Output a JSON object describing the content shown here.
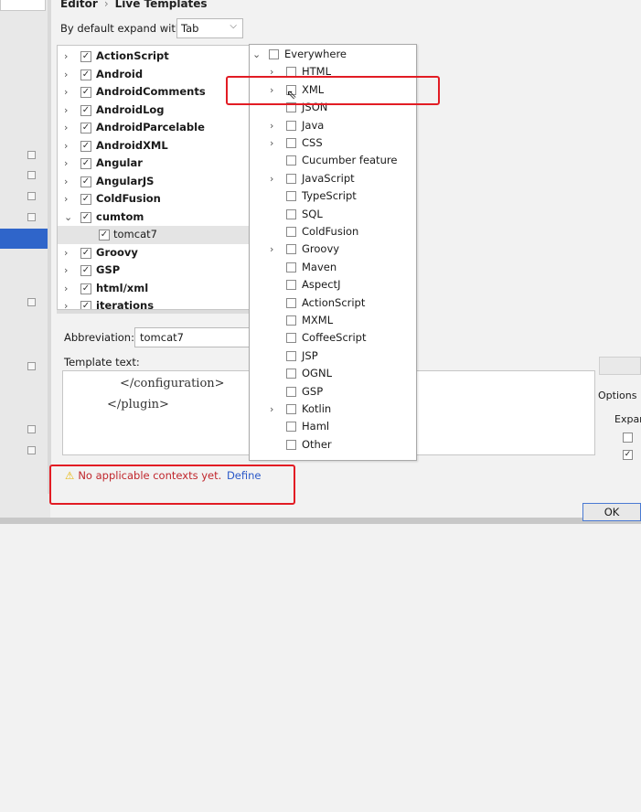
{
  "breadcrumb": {
    "parent": "Editor",
    "separator": "›",
    "current": "Live Templates"
  },
  "expand": {
    "label": "By default expand with",
    "value": "Tab"
  },
  "tree": {
    "items": [
      {
        "label": "ActionScript",
        "checked": true,
        "expanded": false
      },
      {
        "label": "Android",
        "checked": true,
        "expanded": false
      },
      {
        "label": "AndroidComments",
        "checked": true,
        "expanded": false
      },
      {
        "label": "AndroidLog",
        "checked": true,
        "expanded": false
      },
      {
        "label": "AndroidParcelable",
        "checked": true,
        "expanded": false
      },
      {
        "label": "AndroidXML",
        "checked": true,
        "expanded": false
      },
      {
        "label": "Angular",
        "checked": true,
        "expanded": false
      },
      {
        "label": "AngularJS",
        "checked": true,
        "expanded": false
      },
      {
        "label": "ColdFusion",
        "checked": true,
        "expanded": false
      },
      {
        "label": "cumtom",
        "checked": true,
        "expanded": true
      },
      {
        "label": "tomcat7",
        "checked": true,
        "child": true,
        "selected": true
      },
      {
        "label": "Groovy",
        "checked": true,
        "expanded": false
      },
      {
        "label": "GSP",
        "checked": true,
        "expanded": false
      },
      {
        "label": "html/xml",
        "checked": true,
        "expanded": false
      },
      {
        "label": "iterations",
        "checked": true,
        "expanded": false
      }
    ]
  },
  "abbreviation": {
    "label": "Abbreviation:",
    "value": "tomcat7"
  },
  "template": {
    "label": "Template text:",
    "lines": [
      "</configuration>",
      "</plugin>"
    ]
  },
  "options": {
    "label": "Options",
    "expand_label": "Expar"
  },
  "warning": {
    "text": "No applicable contexts yet.",
    "link": "Define"
  },
  "ok_button": "OK",
  "context_popup": {
    "items": [
      {
        "label": "Everywhere",
        "arrow": true,
        "root": true
      },
      {
        "label": "HTML",
        "arrow": true
      },
      {
        "label": "XML",
        "arrow": true
      },
      {
        "label": "JSON",
        "arrow": false
      },
      {
        "label": "Java",
        "arrow": true
      },
      {
        "label": "CSS",
        "arrow": true
      },
      {
        "label": "Cucumber feature",
        "arrow": false
      },
      {
        "label": "JavaScript",
        "arrow": true
      },
      {
        "label": "TypeScript",
        "arrow": false
      },
      {
        "label": "SQL",
        "arrow": false
      },
      {
        "label": "ColdFusion",
        "arrow": false
      },
      {
        "label": "Groovy",
        "arrow": true
      },
      {
        "label": "Maven",
        "arrow": false
      },
      {
        "label": "AspectJ",
        "arrow": false
      },
      {
        "label": "ActionScript",
        "arrow": false
      },
      {
        "label": "MXML",
        "arrow": false
      },
      {
        "label": "CoffeeScript",
        "arrow": false
      },
      {
        "label": "JSP",
        "arrow": false
      },
      {
        "label": "OGNL",
        "arrow": false
      },
      {
        "label": "GSP",
        "arrow": false
      },
      {
        "label": "Kotlin",
        "arrow": true
      },
      {
        "label": "Haml",
        "arrow": false
      },
      {
        "label": "Other",
        "arrow": false
      }
    ]
  },
  "colors": {
    "selection": "#2f65ca",
    "annotation": "#e21c24",
    "warning_text": "#c0262c",
    "link": "#2a58c8"
  }
}
